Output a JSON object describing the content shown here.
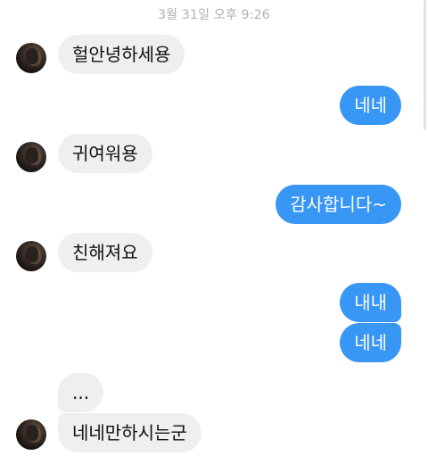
{
  "chat": {
    "timestamp": "3월 31일 오후 9:26",
    "messages": [
      {
        "side": "in",
        "text": "헐안녕하세용"
      },
      {
        "side": "out",
        "text": "네네"
      },
      {
        "side": "in",
        "text": "귀여워용"
      },
      {
        "side": "out",
        "text": "감사합니다~"
      },
      {
        "side": "in",
        "text": "친해져요"
      },
      {
        "side": "out",
        "text": "내내"
      },
      {
        "side": "out",
        "text": "네네"
      },
      {
        "side": "in",
        "text": "..."
      },
      {
        "side": "in",
        "text": "네네만하시는군"
      }
    ]
  },
  "colors": {
    "outgoing_bubble": "#3896f5",
    "incoming_bubble": "#efefef",
    "timestamp_text": "#b0b0b0"
  }
}
